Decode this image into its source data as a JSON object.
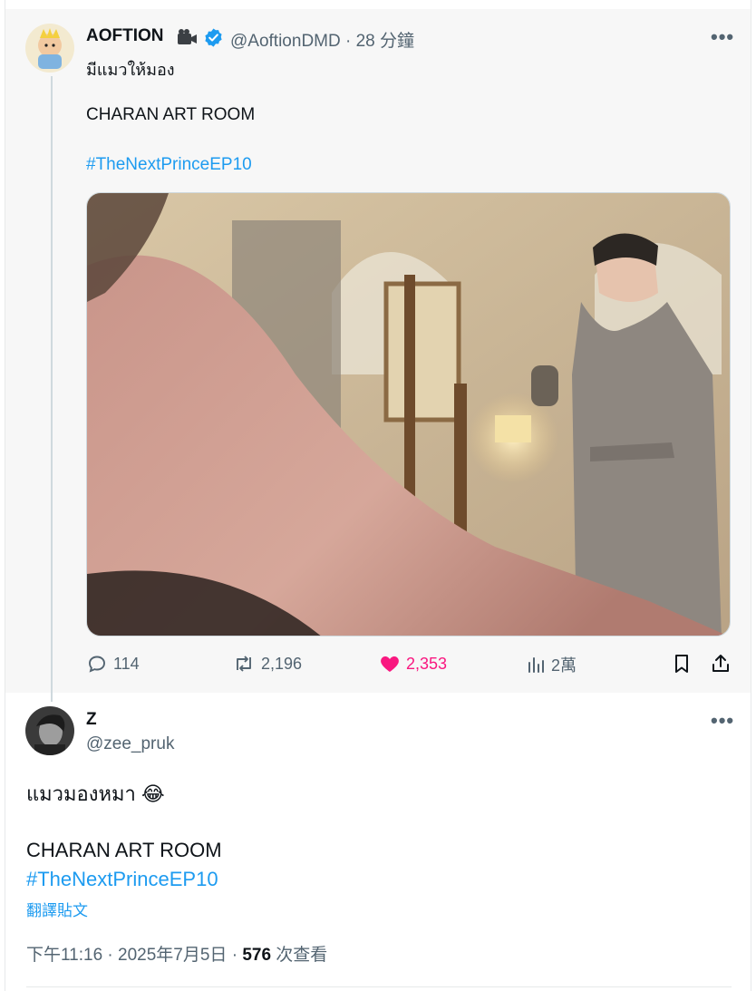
{
  "tweet1": {
    "name": "AOFTION",
    "handle": "@AoftionDMD",
    "time": "· 28 分鐘",
    "line1": "มีแมวให้มอง",
    "line2": "CHARAN ART ROOM",
    "hashtag": "#TheNextPrinceEP10",
    "actions": {
      "replies": "114",
      "reposts": "2,196",
      "likes": "2,353",
      "views": "2萬"
    },
    "icons": [
      "camera-emoji-icon",
      "verified-badge-icon",
      "more-icon",
      "reply-icon",
      "repost-icon",
      "heart-icon",
      "views-icon",
      "bookmark-icon",
      "share-icon"
    ]
  },
  "tweet2": {
    "name": "Z",
    "handle": "@zee_pruk",
    "line1": "แมวมองหมา 😂",
    "line2": "CHARAN ART ROOM",
    "hashtag": "#TheNextPrinceEP10",
    "translate": "翻譯貼文",
    "time": "下午11:16 · 2025年7月5日 ·",
    "views_count": "576",
    "views_label": "次查看"
  },
  "colors": {
    "accent": "#1d9bf0",
    "like": "#f91880",
    "muted": "#536471"
  }
}
